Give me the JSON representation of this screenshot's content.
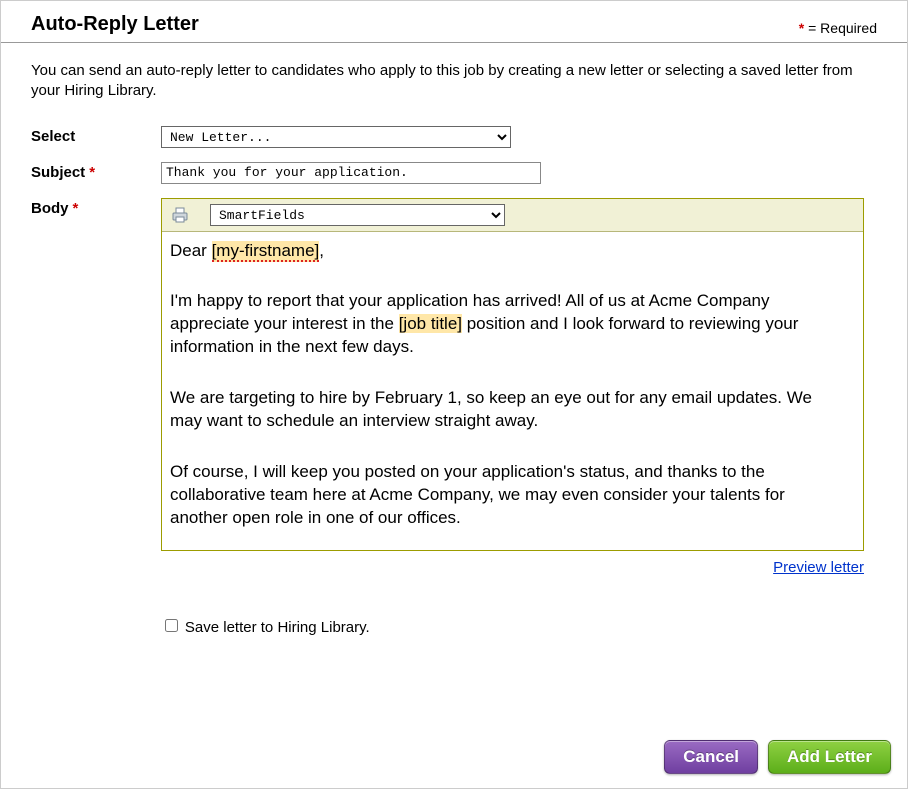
{
  "header": {
    "title": "Auto-Reply Letter",
    "required_legend": " = Required"
  },
  "intro": "You can send an auto-reply letter to candidates who apply to this job by creating a new letter or selecting a saved letter from your Hiring Library.",
  "labels": {
    "select": "Select",
    "subject": "Subject",
    "body": "Body"
  },
  "select_letter": {
    "value": "New Letter..."
  },
  "subject": {
    "value": "Thank you for your application."
  },
  "toolbar": {
    "smartfields": "SmartFields"
  },
  "body": {
    "greeting_prefix": "Dear ",
    "token_firstname": "[my-firstname]",
    "greeting_suffix": ",",
    "p1_a": "I'm happy to report that your application has arrived! All of us at Acme Company appreciate your interest in the ",
    "token_jobtitle": "[job title]",
    "p1_b": " position and I look forward to reviewing your information in the next few days.",
    "p2": "We are targeting to hire by February 1, so keep an eye out for any email updates. We may want to schedule an interview straight away.",
    "p3": "Of course, I will keep you posted on your application's status, and thanks to the collaborative team here at Acme Company, we may even consider your talents for another open role in one of our offices."
  },
  "preview_link": "Preview letter",
  "save_library_label": " Save letter to Hiring Library.",
  "buttons": {
    "cancel": "Cancel",
    "add": "Add Letter"
  }
}
